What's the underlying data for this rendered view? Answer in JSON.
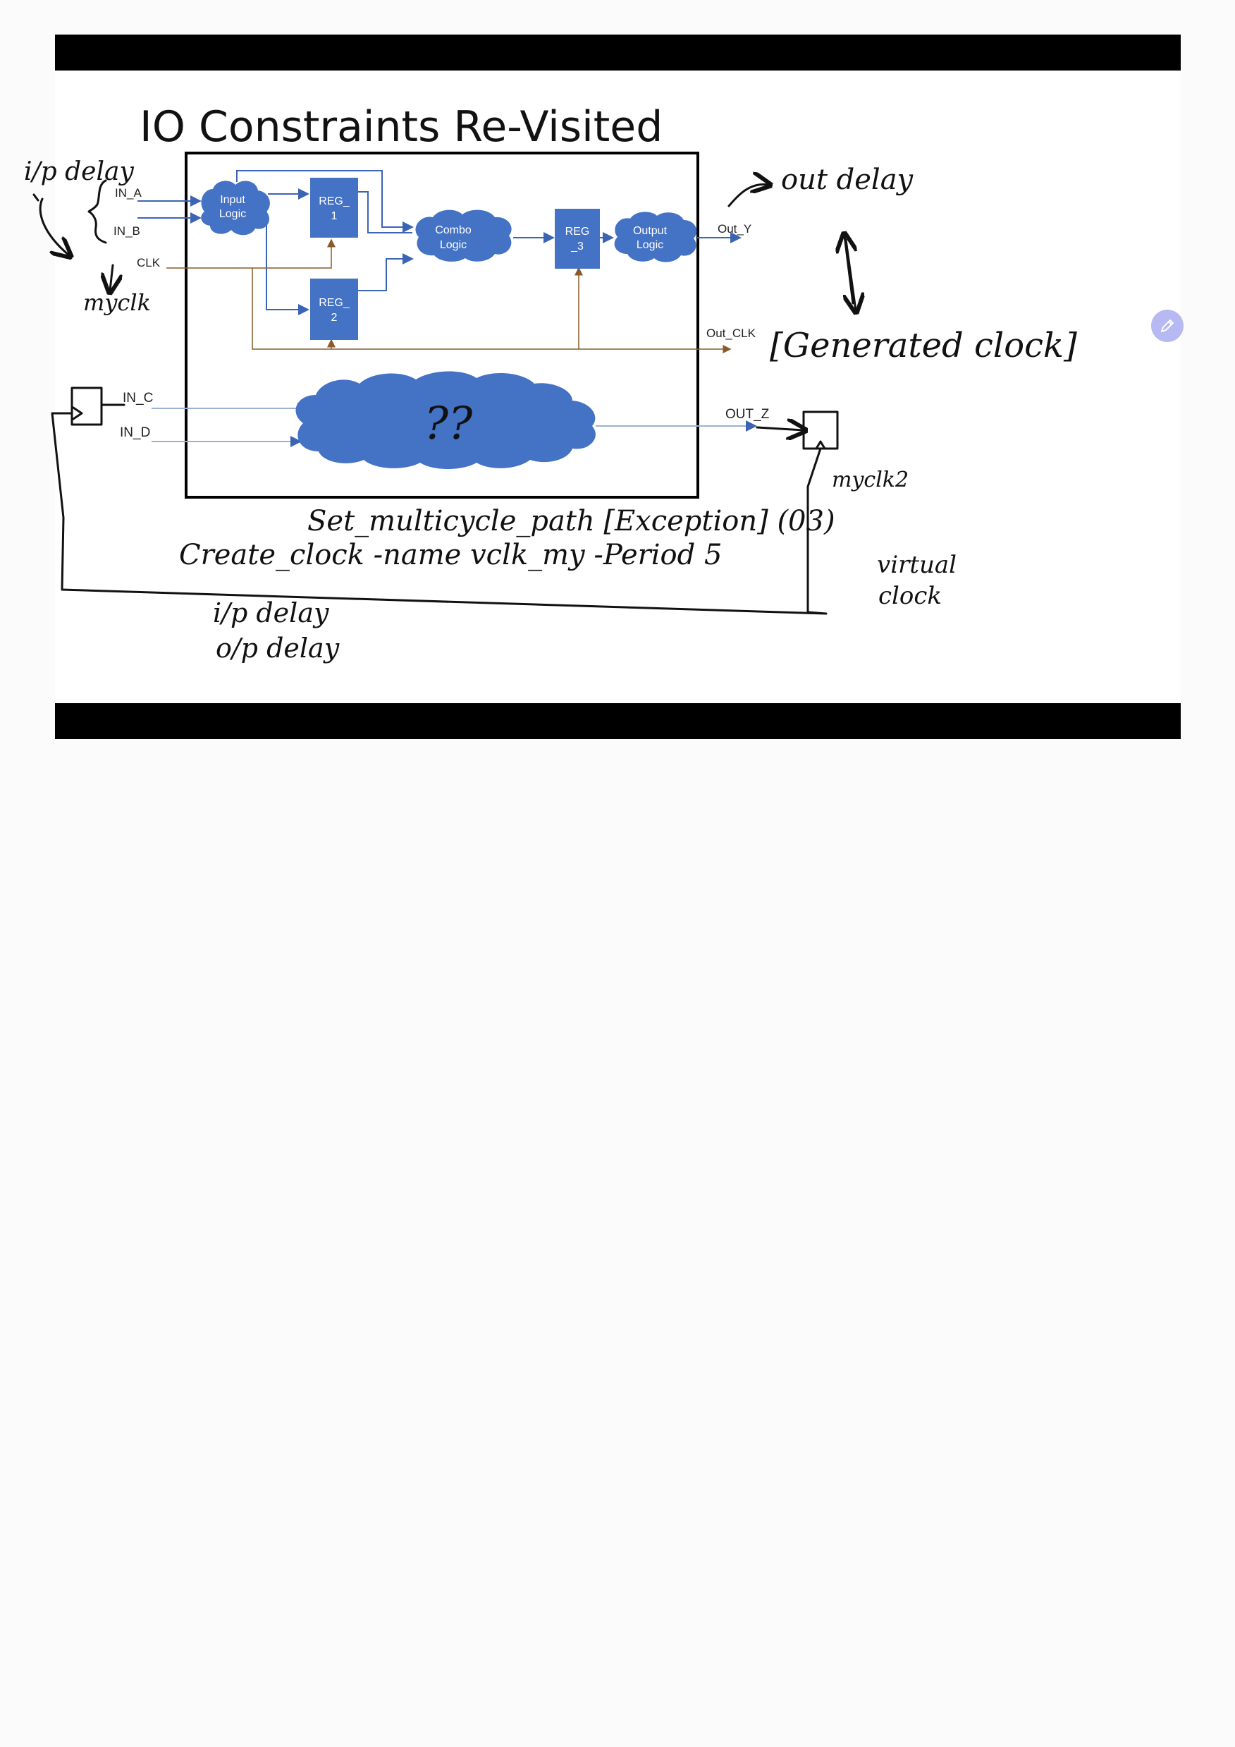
{
  "slide": {
    "title": "IO Constraints Re-Visited"
  },
  "diagram": {
    "inputs": [
      "IN_A",
      "IN_B",
      "CLK",
      "IN_C",
      "IN_D"
    ],
    "outputs": [
      "Out_Y",
      "Out_CLK",
      "OUT_Z"
    ],
    "blocks": {
      "input_logic": [
        "Input",
        "Logic"
      ],
      "reg1": [
        "REG_",
        "1"
      ],
      "reg2": [
        "REG_",
        "2"
      ],
      "combo_logic": [
        "Combo",
        "Logic"
      ],
      "reg3": [
        "REG",
        "_3"
      ],
      "output_logic": [
        "Output",
        "Logic"
      ],
      "unknown_cloud": "??"
    }
  },
  "annotations": {
    "ip_delay_top": "i/p delay",
    "myclk": "myclk",
    "out_delay": "out delay",
    "generated_clock": "[Generated clock]",
    "myclk2": "myclk2",
    "multicycle": "Set_multicycle_path [Exception] (03)",
    "create_clock": "Create_clock  -name  vclk_my  -Period 5",
    "virtual_clock_1": "virtual",
    "virtual_clock_2": "clock",
    "ip_delay_bottom": "i/p delay",
    "op_delay_bottom": "o/p delay"
  },
  "colors": {
    "block_blue": "#4472c4",
    "wire_blue": "#3b64b5",
    "clock_wire": "#8a5a2b",
    "frame_bar": "#000000",
    "edit_button": "#b7b9f2"
  },
  "icons": {
    "edit": "pencil-icon"
  }
}
